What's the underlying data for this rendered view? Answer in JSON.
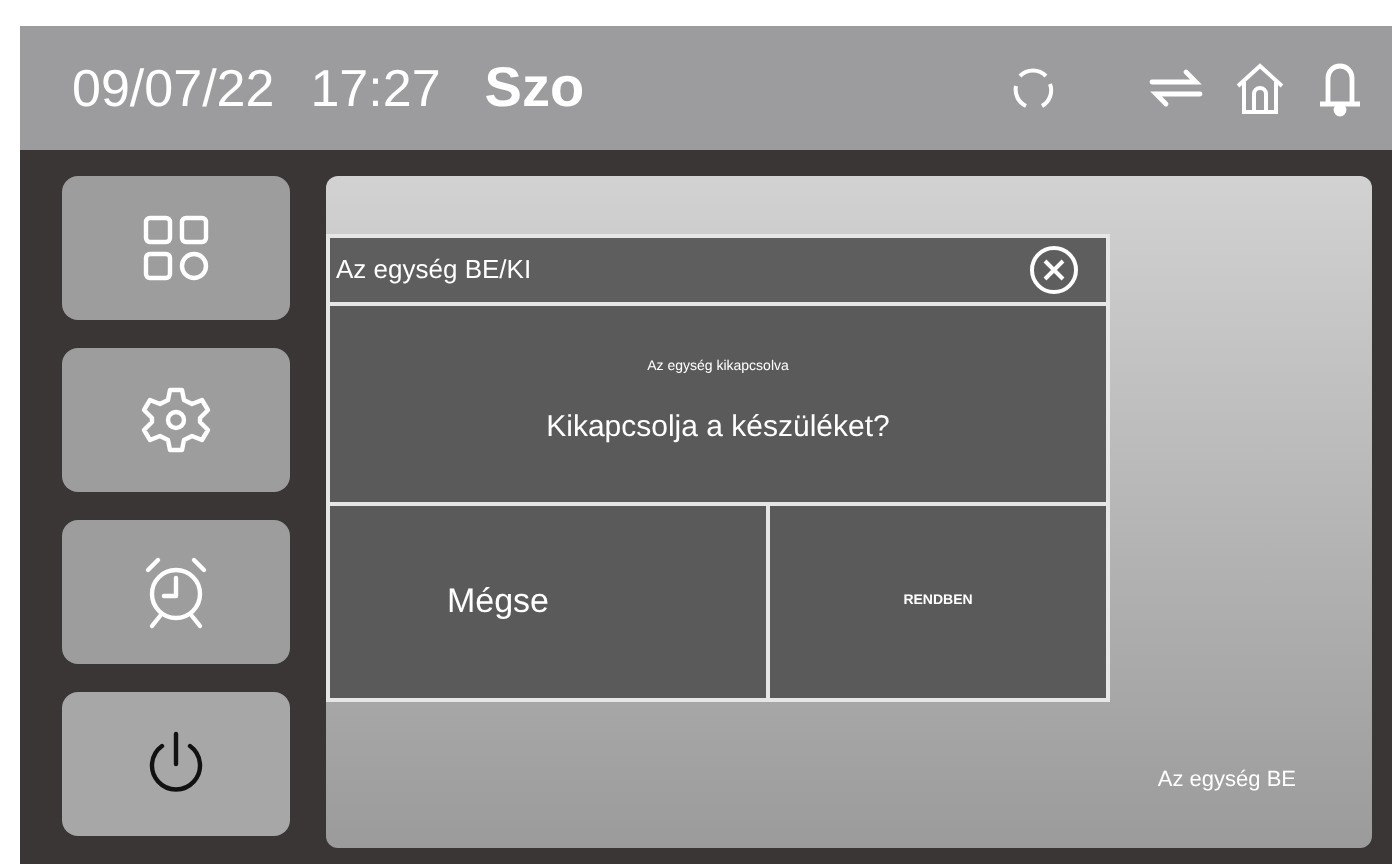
{
  "status_bar": {
    "date": "09/07/22",
    "time": "17:27",
    "day": "Szo"
  },
  "sidebar": {
    "items": [
      {
        "kind": "apps",
        "selected": false
      },
      {
        "kind": "settings",
        "selected": false
      },
      {
        "kind": "alarm",
        "selected": false
      },
      {
        "kind": "power",
        "selected": true
      }
    ]
  },
  "dialog": {
    "title": "Az egység BE/KI",
    "subtitle": "Az egység kikapcsolva",
    "question": "Kikapcsolja a készüléket?",
    "buttons": [
      "Mégse",
      "RENDBEN"
    ]
  },
  "panel": {
    "status": "Az egység BE"
  }
}
